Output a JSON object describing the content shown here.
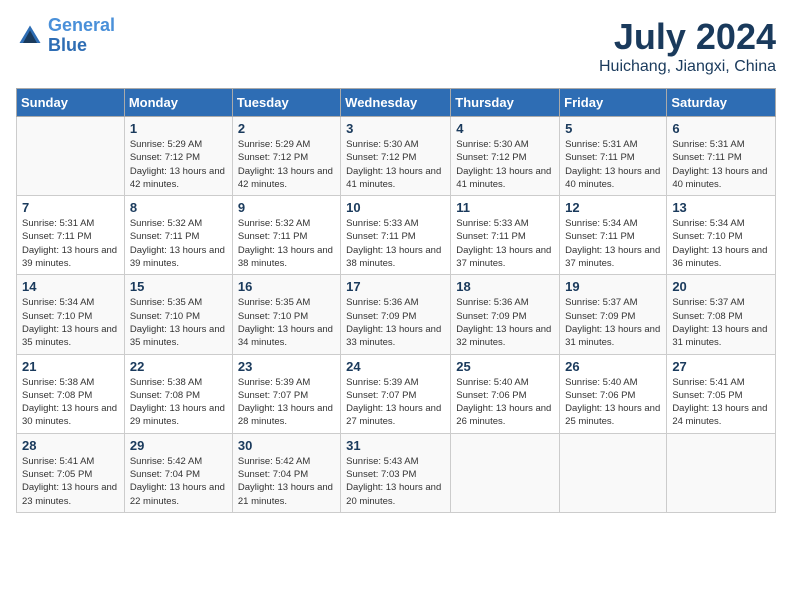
{
  "header": {
    "logo_line1": "General",
    "logo_line2": "Blue",
    "month_year": "July 2024",
    "location": "Huichang, Jiangxi, China"
  },
  "weekdays": [
    "Sunday",
    "Monday",
    "Tuesday",
    "Wednesday",
    "Thursday",
    "Friday",
    "Saturday"
  ],
  "weeks": [
    [
      {
        "day": "",
        "sunrise": "",
        "sunset": "",
        "daylight": ""
      },
      {
        "day": "1",
        "sunrise": "Sunrise: 5:29 AM",
        "sunset": "Sunset: 7:12 PM",
        "daylight": "Daylight: 13 hours and 42 minutes."
      },
      {
        "day": "2",
        "sunrise": "Sunrise: 5:29 AM",
        "sunset": "Sunset: 7:12 PM",
        "daylight": "Daylight: 13 hours and 42 minutes."
      },
      {
        "day": "3",
        "sunrise": "Sunrise: 5:30 AM",
        "sunset": "Sunset: 7:12 PM",
        "daylight": "Daylight: 13 hours and 41 minutes."
      },
      {
        "day": "4",
        "sunrise": "Sunrise: 5:30 AM",
        "sunset": "Sunset: 7:12 PM",
        "daylight": "Daylight: 13 hours and 41 minutes."
      },
      {
        "day": "5",
        "sunrise": "Sunrise: 5:31 AM",
        "sunset": "Sunset: 7:11 PM",
        "daylight": "Daylight: 13 hours and 40 minutes."
      },
      {
        "day": "6",
        "sunrise": "Sunrise: 5:31 AM",
        "sunset": "Sunset: 7:11 PM",
        "daylight": "Daylight: 13 hours and 40 minutes."
      }
    ],
    [
      {
        "day": "7",
        "sunrise": "Sunrise: 5:31 AM",
        "sunset": "Sunset: 7:11 PM",
        "daylight": "Daylight: 13 hours and 39 minutes."
      },
      {
        "day": "8",
        "sunrise": "Sunrise: 5:32 AM",
        "sunset": "Sunset: 7:11 PM",
        "daylight": "Daylight: 13 hours and 39 minutes."
      },
      {
        "day": "9",
        "sunrise": "Sunrise: 5:32 AM",
        "sunset": "Sunset: 7:11 PM",
        "daylight": "Daylight: 13 hours and 38 minutes."
      },
      {
        "day": "10",
        "sunrise": "Sunrise: 5:33 AM",
        "sunset": "Sunset: 7:11 PM",
        "daylight": "Daylight: 13 hours and 38 minutes."
      },
      {
        "day": "11",
        "sunrise": "Sunrise: 5:33 AM",
        "sunset": "Sunset: 7:11 PM",
        "daylight": "Daylight: 13 hours and 37 minutes."
      },
      {
        "day": "12",
        "sunrise": "Sunrise: 5:34 AM",
        "sunset": "Sunset: 7:11 PM",
        "daylight": "Daylight: 13 hours and 37 minutes."
      },
      {
        "day": "13",
        "sunrise": "Sunrise: 5:34 AM",
        "sunset": "Sunset: 7:10 PM",
        "daylight": "Daylight: 13 hours and 36 minutes."
      }
    ],
    [
      {
        "day": "14",
        "sunrise": "Sunrise: 5:34 AM",
        "sunset": "Sunset: 7:10 PM",
        "daylight": "Daylight: 13 hours and 35 minutes."
      },
      {
        "day": "15",
        "sunrise": "Sunrise: 5:35 AM",
        "sunset": "Sunset: 7:10 PM",
        "daylight": "Daylight: 13 hours and 35 minutes."
      },
      {
        "day": "16",
        "sunrise": "Sunrise: 5:35 AM",
        "sunset": "Sunset: 7:10 PM",
        "daylight": "Daylight: 13 hours and 34 minutes."
      },
      {
        "day": "17",
        "sunrise": "Sunrise: 5:36 AM",
        "sunset": "Sunset: 7:09 PM",
        "daylight": "Daylight: 13 hours and 33 minutes."
      },
      {
        "day": "18",
        "sunrise": "Sunrise: 5:36 AM",
        "sunset": "Sunset: 7:09 PM",
        "daylight": "Daylight: 13 hours and 32 minutes."
      },
      {
        "day": "19",
        "sunrise": "Sunrise: 5:37 AM",
        "sunset": "Sunset: 7:09 PM",
        "daylight": "Daylight: 13 hours and 31 minutes."
      },
      {
        "day": "20",
        "sunrise": "Sunrise: 5:37 AM",
        "sunset": "Sunset: 7:08 PM",
        "daylight": "Daylight: 13 hours and 31 minutes."
      }
    ],
    [
      {
        "day": "21",
        "sunrise": "Sunrise: 5:38 AM",
        "sunset": "Sunset: 7:08 PM",
        "daylight": "Daylight: 13 hours and 30 minutes."
      },
      {
        "day": "22",
        "sunrise": "Sunrise: 5:38 AM",
        "sunset": "Sunset: 7:08 PM",
        "daylight": "Daylight: 13 hours and 29 minutes."
      },
      {
        "day": "23",
        "sunrise": "Sunrise: 5:39 AM",
        "sunset": "Sunset: 7:07 PM",
        "daylight": "Daylight: 13 hours and 28 minutes."
      },
      {
        "day": "24",
        "sunrise": "Sunrise: 5:39 AM",
        "sunset": "Sunset: 7:07 PM",
        "daylight": "Daylight: 13 hours and 27 minutes."
      },
      {
        "day": "25",
        "sunrise": "Sunrise: 5:40 AM",
        "sunset": "Sunset: 7:06 PM",
        "daylight": "Daylight: 13 hours and 26 minutes."
      },
      {
        "day": "26",
        "sunrise": "Sunrise: 5:40 AM",
        "sunset": "Sunset: 7:06 PM",
        "daylight": "Daylight: 13 hours and 25 minutes."
      },
      {
        "day": "27",
        "sunrise": "Sunrise: 5:41 AM",
        "sunset": "Sunset: 7:05 PM",
        "daylight": "Daylight: 13 hours and 24 minutes."
      }
    ],
    [
      {
        "day": "28",
        "sunrise": "Sunrise: 5:41 AM",
        "sunset": "Sunset: 7:05 PM",
        "daylight": "Daylight: 13 hours and 23 minutes."
      },
      {
        "day": "29",
        "sunrise": "Sunrise: 5:42 AM",
        "sunset": "Sunset: 7:04 PM",
        "daylight": "Daylight: 13 hours and 22 minutes."
      },
      {
        "day": "30",
        "sunrise": "Sunrise: 5:42 AM",
        "sunset": "Sunset: 7:04 PM",
        "daylight": "Daylight: 13 hours and 21 minutes."
      },
      {
        "day": "31",
        "sunrise": "Sunrise: 5:43 AM",
        "sunset": "Sunset: 7:03 PM",
        "daylight": "Daylight: 13 hours and 20 minutes."
      },
      {
        "day": "",
        "sunrise": "",
        "sunset": "",
        "daylight": ""
      },
      {
        "day": "",
        "sunrise": "",
        "sunset": "",
        "daylight": ""
      },
      {
        "day": "",
        "sunrise": "",
        "sunset": "",
        "daylight": ""
      }
    ]
  ]
}
